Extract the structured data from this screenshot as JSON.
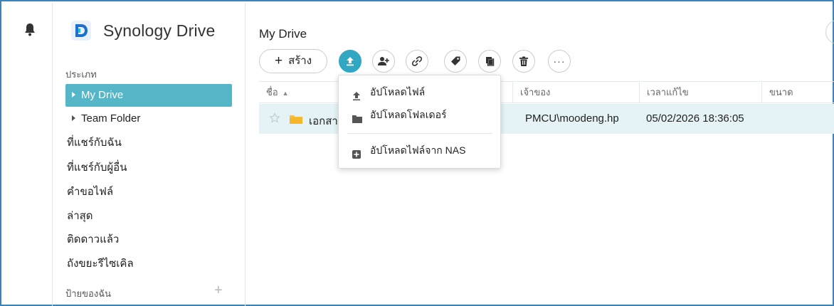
{
  "app": {
    "title": "Synology Drive"
  },
  "sidebar": {
    "category_label": "ประเภท",
    "items": [
      {
        "label": "My Drive",
        "active": true,
        "expandable": true
      },
      {
        "label": "Team Folder",
        "active": false,
        "expandable": true
      },
      {
        "label": "ที่แชร์กับฉัน",
        "active": false,
        "expandable": false
      },
      {
        "label": "ที่แชร์กับผู้อื่น",
        "active": false,
        "expandable": false
      },
      {
        "label": "คำขอไฟล์",
        "active": false,
        "expandable": false
      },
      {
        "label": "ล่าสุด",
        "active": false,
        "expandable": false
      },
      {
        "label": "ติดดาวแล้ว",
        "active": false,
        "expandable": false
      },
      {
        "label": "ถังขยะรีไซเคิล",
        "active": false,
        "expandable": false
      }
    ],
    "tags_label": "ป้ายของฉัน",
    "tags_add": "+"
  },
  "main": {
    "title": "My Drive",
    "toolbar": {
      "create_label": "สร้าง",
      "create_plus": "+",
      "more_label": "···",
      "buttons": [
        "upload-icon",
        "add-user-icon",
        "link-icon",
        "tag-icon",
        "copy-icon",
        "trash-icon",
        "more-icon"
      ]
    },
    "table": {
      "columns": [
        "ชื่อ",
        "เจ้าของ",
        "เวลาแก้ไข",
        "ขนาด"
      ],
      "sort_indicator": "▲",
      "rows": [
        {
          "name": "เอกสาร",
          "owner": "PMCU\\moodeng.hp",
          "modified": "05/02/2026 18:36:05",
          "size": ""
        }
      ]
    }
  },
  "upload_menu": {
    "items": [
      {
        "label": "อัปโหลดไฟล์",
        "icon": "upload-arrow-icon"
      },
      {
        "label": "อัปโหลดโฟลเดอร์",
        "icon": "folder-icon"
      },
      {
        "label": "อัปโหลดไฟล์จาก NAS",
        "icon": "nas-plus-icon"
      }
    ]
  },
  "colors": {
    "accent": "#55b6c8",
    "active_button": "#31a7c4",
    "row_highlight": "#e6f3f6",
    "frame_border": "#3b83bd"
  }
}
